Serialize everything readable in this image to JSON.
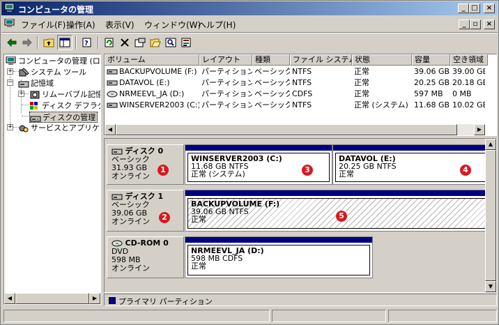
{
  "window": {
    "title": "コンピュータの管理",
    "min": "_",
    "max": "□",
    "close": "×"
  },
  "menu": {
    "items": [
      "ファイル(F)",
      "操作(A)",
      "表示(V)",
      "ウィンドウ(W)",
      "ヘルプ(H)"
    ],
    "mdi_min": "_",
    "mdi_restore": "▫",
    "mdi_close": "×"
  },
  "toolbar": {
    "icons": [
      "back-icon",
      "forward-icon",
      "up-folder-icon",
      "show-hide-tree-icon",
      "help-icon",
      "refresh-icon",
      "delete-icon",
      "properties-icon",
      "open-icon",
      "search-icon",
      "settings-icon"
    ]
  },
  "tree": {
    "root": "コンピュータの管理 (ロー",
    "system_tools": "システム ツール",
    "storage": "記憶域",
    "removable": "リムーバブル記憶",
    "defrag": "ディスク デフラグ",
    "disk_mgmt": "ディスクの管理",
    "services": "サービスとアプリケーシ"
  },
  "list": {
    "columns": [
      "ボリューム",
      "レイアウト",
      "種類",
      "ファイル システム",
      "状態",
      "容量",
      "空き領域"
    ],
    "rows": [
      [
        "BACKUPVOLUME (F:)",
        "パーティション",
        "ベーシック",
        "NTFS",
        "正常",
        "39.06 GB",
        "39.00 GB"
      ],
      [
        "DATAVOL (E:)",
        "パーティション",
        "ベーシック",
        "NTFS",
        "正常",
        "20.25 GB",
        "20.18 GB"
      ],
      [
        "NRMEEVL_JA (D:)",
        "パーティション",
        "ベーシック",
        "CDFS",
        "正常",
        "597 MB",
        "0 MB"
      ],
      [
        "WINSERVER2003 (C:)",
        "パーティション",
        "ベーシック",
        "NTFS",
        "正常 (システム)",
        "11.68 GB",
        "10.02 GB"
      ]
    ]
  },
  "disks": [
    {
      "name": "ディスク 0",
      "type": "ベーシック",
      "size": "31.93 GB",
      "status": "オンライン",
      "marker": "1"
    },
    {
      "name": "ディスク 1",
      "type": "ベーシック",
      "size": "39.06 GB",
      "status": "オンライン",
      "marker": "2"
    },
    {
      "name": "CD-ROM 0",
      "type": "DVD",
      "size": "598 MB",
      "status": "オンライン"
    }
  ],
  "partitions": [
    {
      "name": "WINSERVER2003 (C:)",
      "detail": "11.68 GB NTFS",
      "status": "正常 (システム)",
      "marker": "3"
    },
    {
      "name": "DATAVOL (E:)",
      "detail": "20.25 GB NTFS",
      "status": "正常",
      "marker": "4"
    },
    {
      "name": "BACKUPVOLUME (F:)",
      "detail": "39.06 GB NTFS",
      "status": "正常",
      "marker": "5"
    },
    {
      "name": "NRMEEVL_JA (D:)",
      "detail": "598 MB CDFS",
      "status": "正常"
    }
  ],
  "legend": {
    "primary": "プライマリ パーティション",
    "color": "#000080"
  },
  "colors": {
    "titlebar_start": "#0a246a",
    "titlebar_end": "#a6caf0",
    "partition_bar": "#000080",
    "marker": "#d71920"
  }
}
